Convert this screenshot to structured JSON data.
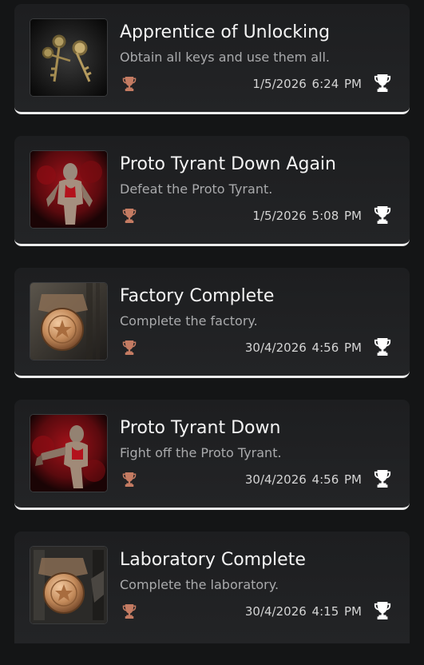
{
  "trophies": [
    {
      "title": "Apprentice of Unlocking",
      "description": "Obtain all keys and use them all.",
      "earned": "1/5/2026  6:24 PM",
      "grade": "bronze",
      "image_icon": "keys-icon"
    },
    {
      "title": "Proto Tyrant Down Again",
      "description": "Defeat the Proto Tyrant.",
      "earned": "1/5/2026  5:08 PM",
      "grade": "bronze",
      "image_icon": "tyrant-icon"
    },
    {
      "title": "Factory Complete",
      "description": "Complete the factory.",
      "earned": "30/4/2026  4:56 PM",
      "grade": "bronze",
      "image_icon": "stars-badge-icon"
    },
    {
      "title": "Proto Tyrant Down",
      "description": "Fight off the Proto Tyrant.",
      "earned": "30/4/2026  4:56 PM",
      "grade": "bronze",
      "image_icon": "tyrant-icon"
    },
    {
      "title": "Laboratory Complete",
      "description": "Complete the laboratory.",
      "earned": "30/4/2026  4:15 PM",
      "grade": "bronze",
      "image_icon": "stars-badge-icon"
    }
  ],
  "colors": {
    "bronze": "#c47b62",
    "earned_trophy": "#ffffff",
    "card_bg": "#1f2022",
    "page_bg": "#141516"
  }
}
